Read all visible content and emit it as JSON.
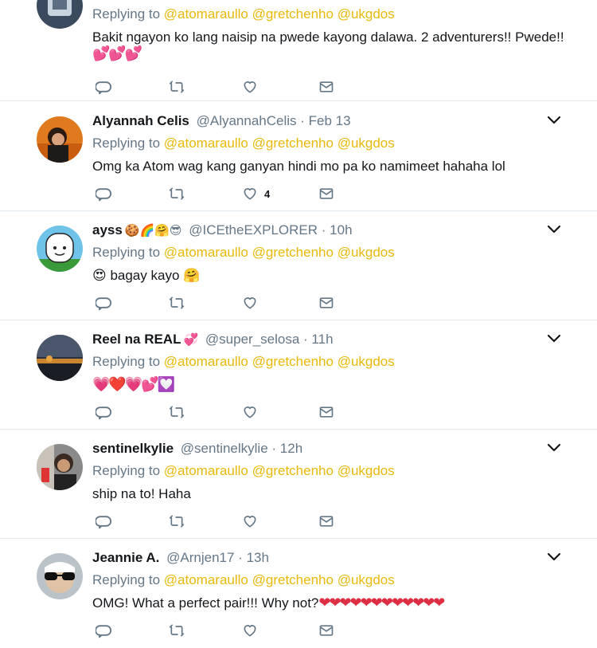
{
  "replying_prefix": "Replying to",
  "mentions": [
    "@atomaraullo",
    "@gretchenho",
    "@ukgdos"
  ],
  "tweets": [
    {
      "name": "",
      "handle": "",
      "time": "",
      "text": "Bakit ngayon ko lang naisip na pwede kayong dalawa. 2 adventurers!! Pwede!!",
      "hearts": "💕💕💕",
      "likes": "",
      "avatar": "partial-photo"
    },
    {
      "name": "Alyannah Celis",
      "name_emoji": "",
      "handle": "@AlyannahCelis",
      "time": "· Feb 13",
      "text": "Omg ka Atom wag kang ganyan hindi mo pa ko namimeet hahaha lol",
      "likes": "4",
      "avatar": "woman-photo"
    },
    {
      "name": "ayss",
      "name_emoji": "🍪🌈🤗😎",
      "handle": "@ICEtheEXPLORER",
      "time": "· 10h",
      "text": "😍 bagay kayo 🤗",
      "likes": "",
      "avatar": "cartoon-finn"
    },
    {
      "name": "Reel na REAL",
      "name_emoji": "💞",
      "handle": "@super_selosa",
      "time": "· 11h",
      "text": "💗❤️💗💕💟",
      "likes": "",
      "avatar": "sunset-photo"
    },
    {
      "name": "sentinelkylie",
      "name_emoji": "",
      "handle": "@sentinelkylie",
      "time": "· 12h",
      "text": "ship na to! Haha",
      "likes": "",
      "avatar": "selfie-photo"
    },
    {
      "name": "Jeannie A.",
      "name_emoji": "",
      "handle": "@Arnjen17",
      "time": "· 13h",
      "text": "OMG! What a perfect pair!!! Why not?",
      "hearts": "❤❤❤❤❤❤❤❤❤❤❤❤",
      "likes": "",
      "avatar": "sunglasses-photo"
    }
  ],
  "colors": {
    "mention": "#e8b90a",
    "muted": "#657786",
    "heart": "#dd2e44",
    "divider": "#e1e8ed"
  },
  "icons": [
    "reply-icon",
    "retweet-icon",
    "like-icon",
    "dm-icon",
    "chevron-down-icon"
  ]
}
